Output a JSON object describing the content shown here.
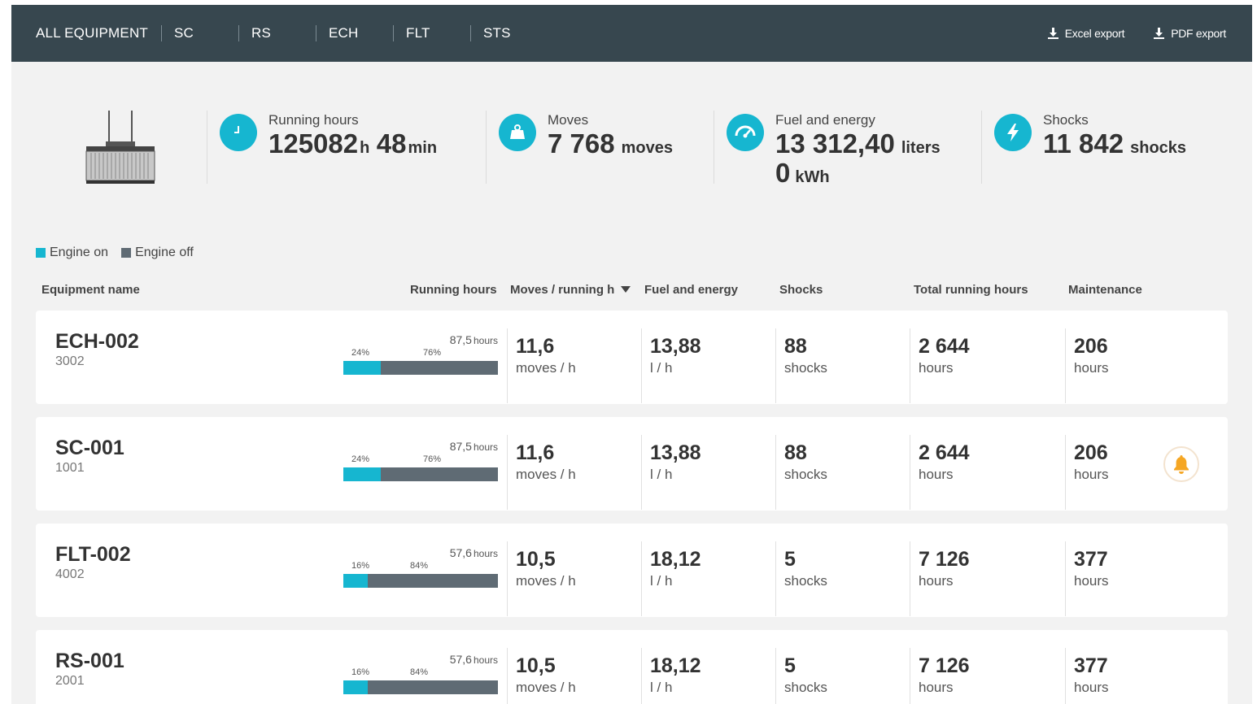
{
  "tabs": [
    "ALL EQUIPMENT",
    "SC",
    "RS",
    "ECH",
    "FLT",
    "STS"
  ],
  "exports": {
    "excel": "Excel export",
    "pdf": "PDF export"
  },
  "colors": {
    "accent": "#16b6d0",
    "engine_off": "#5f6b74",
    "topbar": "#37474f",
    "alert": "#f5a623"
  },
  "summary": {
    "running": {
      "label": "Running hours",
      "value1": "125082",
      "unit1": "h",
      "value2": "48",
      "unit2": "min",
      "icon": "clock-icon"
    },
    "moves": {
      "label": "Moves",
      "value": "7 768",
      "unit": "moves",
      "icon": "weight-icon"
    },
    "fuel": {
      "label": "Fuel and energy",
      "value": "13 312,40",
      "unit": "liters",
      "value2": "0",
      "unit2": "kWh",
      "icon": "gauge-icon"
    },
    "shocks": {
      "label": "Shocks",
      "value": "11 842",
      "unit": "shocks",
      "icon": "lightning-icon"
    }
  },
  "legend": {
    "on": "Engine on",
    "off": "Engine off"
  },
  "columns": {
    "name": "Equipment name",
    "running": "Running hours",
    "moves": "Moves / running h",
    "fuel": "Fuel and energy",
    "shocks": "Shocks",
    "total": "Total running hours",
    "maint": "Maintenance"
  },
  "rows": [
    {
      "name": "ECH-002",
      "code": "3002",
      "hours": "87,5",
      "hours_unit": "hours",
      "on_pct": "24%",
      "off_pct": "76%",
      "on_fraction": 0.24,
      "moves": "11,6",
      "moves_unit": "moves / h",
      "fuel": "13,88",
      "fuel_unit": "l / h",
      "shocks": "88",
      "shocks_unit": "shocks",
      "total": "2 644",
      "total_unit": "hours",
      "maint": "206",
      "maint_unit": "hours",
      "alert": false
    },
    {
      "name": "SC-001",
      "code": "1001",
      "hours": "87,5",
      "hours_unit": "hours",
      "on_pct": "24%",
      "off_pct": "76%",
      "on_fraction": 0.24,
      "moves": "11,6",
      "moves_unit": "moves / h",
      "fuel": "13,88",
      "fuel_unit": "l / h",
      "shocks": "88",
      "shocks_unit": "shocks",
      "total": "2 644",
      "total_unit": "hours",
      "maint": "206",
      "maint_unit": "hours",
      "alert": true
    },
    {
      "name": "FLT-002",
      "code": "4002",
      "hours": "57,6",
      "hours_unit": "hours",
      "on_pct": "16%",
      "off_pct": "84%",
      "on_fraction": 0.16,
      "moves": "10,5",
      "moves_unit": "moves / h",
      "fuel": "18,12",
      "fuel_unit": "l / h",
      "shocks": "5",
      "shocks_unit": "shocks",
      "total": "7 126",
      "total_unit": "hours",
      "maint": "377",
      "maint_unit": "hours",
      "alert": false
    },
    {
      "name": "RS-001",
      "code": "2001",
      "hours": "57,6",
      "hours_unit": "hours",
      "on_pct": "16%",
      "off_pct": "84%",
      "on_fraction": 0.16,
      "moves": "10,5",
      "moves_unit": "moves / h",
      "fuel": "18,12",
      "fuel_unit": "l / h",
      "shocks": "5",
      "shocks_unit": "shocks",
      "total": "7 126",
      "total_unit": "hours",
      "maint": "377",
      "maint_unit": "hours",
      "alert": false
    }
  ]
}
